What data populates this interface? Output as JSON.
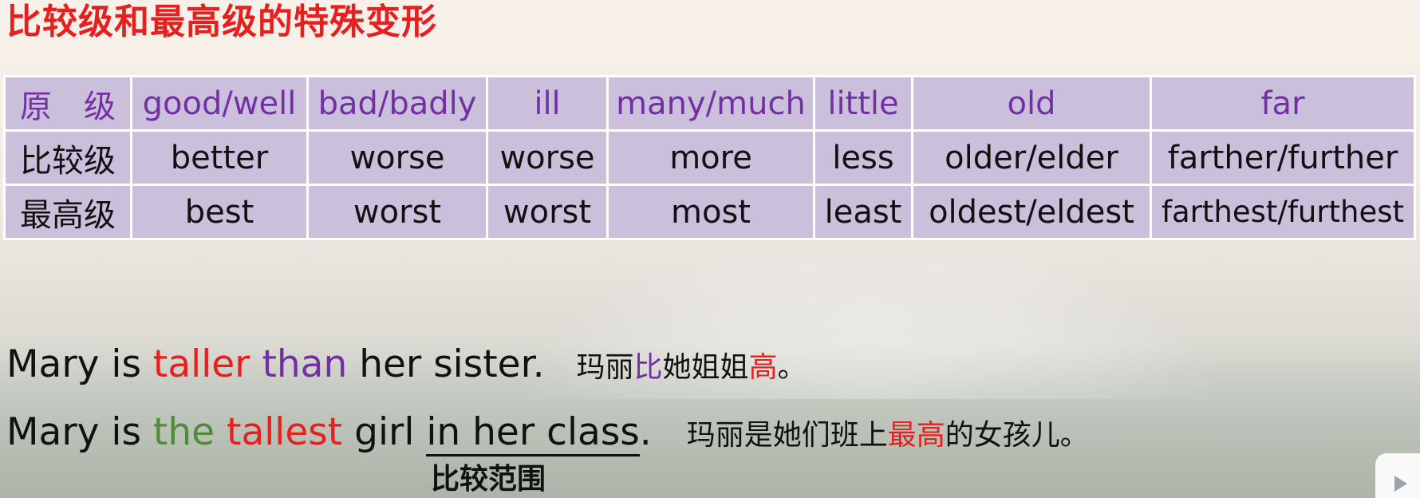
{
  "title": "比较级和最高级的特殊变形",
  "table": {
    "header": [
      "原　级",
      "good/well",
      "bad/badly",
      "ill",
      "many/much",
      "little",
      "old",
      "far"
    ],
    "comparative": [
      "比较级",
      "better",
      "worse",
      "worse",
      "more",
      "less",
      "older/elder",
      "farther/further"
    ],
    "superlative": [
      "最高级",
      "best",
      "worst",
      "worst",
      "most",
      "least",
      "oldest/eldest",
      "farthest/furthest"
    ]
  },
  "sentence1": {
    "part1": "Mary is ",
    "part2": "taller",
    "part3": " ",
    "part4": "than",
    "part5": " her sister.",
    "zh_part1": "玛丽",
    "zh_part2": "比",
    "zh_part3": "她姐姐",
    "zh_part4": "高",
    "zh_part5": "。"
  },
  "sentence2": {
    "part1": "Mary is ",
    "part2": "the",
    "part3": " ",
    "part4": "tallest",
    "part5": " girl ",
    "part6": "in her class",
    "part7": ".",
    "zh_part1": "玛丽是她们班上",
    "zh_part2": "最高",
    "zh_part3": "的女孩儿。"
  },
  "scope_label": "比较范围",
  "colors": {
    "title": "#e5201e",
    "table_cell": "#cbc0db",
    "header_text": "#7330a6",
    "red": "#e5201e",
    "purple": "#7330a6",
    "green": "#4f8c3a"
  },
  "icons": {
    "corner": "play-icon"
  }
}
